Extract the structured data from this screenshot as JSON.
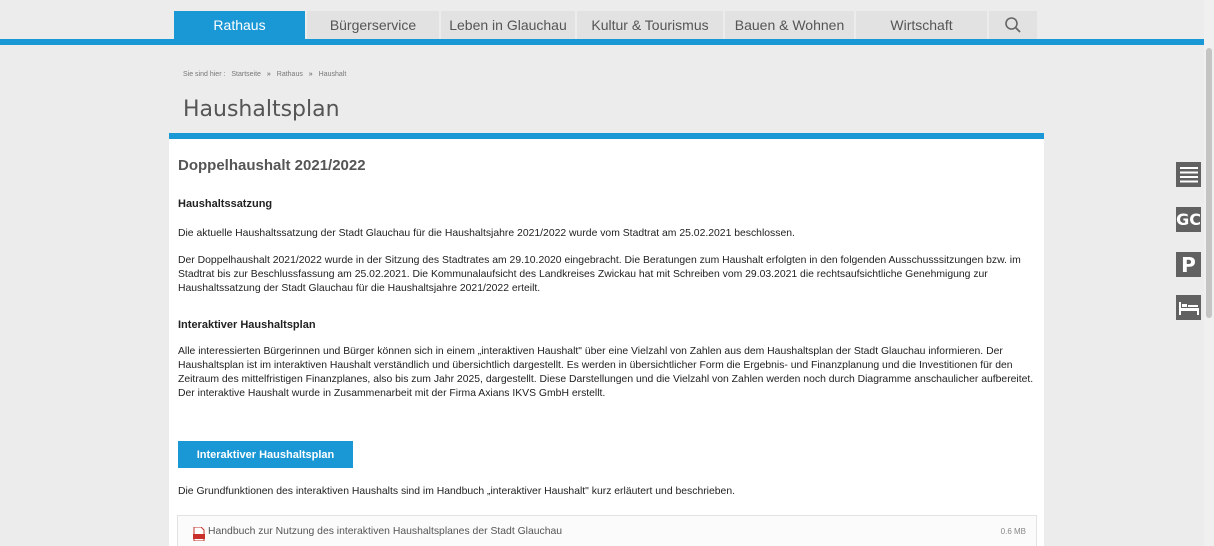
{
  "nav": {
    "items": [
      {
        "label": "Rathaus",
        "active": true
      },
      {
        "label": "Bürgerservice",
        "active": false
      },
      {
        "label": "Leben in Glauchau",
        "active": false
      },
      {
        "label": "Kultur & Tourismus",
        "active": false
      },
      {
        "label": "Bauen & Wohnen",
        "active": false
      },
      {
        "label": "Wirtschaft",
        "active": false
      }
    ],
    "search_icon": "search-icon"
  },
  "breadcrumb": {
    "prefix": "Sie sind hier :",
    "items": [
      "Startseite",
      "Rathaus",
      "Haushalt"
    ],
    "separator": "»"
  },
  "page_title": "Haushaltsplan",
  "content": {
    "section_title": "Doppelhaushalt 2021/2022",
    "heading1": "Haushaltssatzung",
    "para1": "Die aktuelle Haushaltssatzung der Stadt Glauchau für die Haushaltsjahre 2021/2022 wurde vom Stadtrat am 25.02.2021 beschlossen.",
    "para2": "Der Doppelhaushalt 2021/2022 wurde in der Sitzung des Stadtrates am 29.10.2020 eingebracht. Die Beratungen zum Haushalt erfolgten in den folgenden Ausschusssitzungen bzw. im Stadtrat bis zur Beschlussfassung am 25.02.2021. Die Kommunalaufsicht des Landkreises Zwickau hat mit Schreiben vom 29.03.2021 die rechtsaufsichtliche Genehmigung zur Haushaltssatzung der Stadt Glauchau für die Haushaltsjahre 2021/2022 erteilt.",
    "heading2": "Interaktiver Haushaltsplan",
    "para3": "Alle interessierten Bürgerinnen und Bürger können sich in einem „interaktiven Haushalt\" über eine Vielzahl von Zahlen aus dem Haushaltsplan der Stadt Glauchau informieren. Der Haushaltsplan ist im interaktiven Haushalt verständlich und übersichtlich dargestellt. Es werden in übersichtlicher Form die Ergebnis- und Finanzplanung und die Investitionen für den Zeitraum des mittelfristigen Finanzplanes, also bis zum Jahr 2025, dargestellt. Diese Darstellungen und die Vielzahl von Zahlen werden noch durch Diagramme anschaulicher aufbereitet. Der interaktive Haushalt wurde in Zusammenarbeit mit der Firma Axians IKVS GmbH erstellt.",
    "button_label": "Interaktiver Haushaltsplan",
    "para4": "Die Grundfunktionen des interaktiven Haushalts sind im Handbuch „interaktiver Haushalt\" kurz erläutert und beschrieben.",
    "download": {
      "icon": "pdf-icon",
      "label": "Handbuch zur Nutzung des interaktiven Haushaltsplanes der Stadt Glauchau",
      "size": "0.6 MB"
    }
  },
  "side_tools": [
    {
      "icon": "menu-lines-icon",
      "text": ""
    },
    {
      "icon": "gc-icon",
      "text": "GC"
    },
    {
      "icon": "parking-icon",
      "text": "P"
    },
    {
      "icon": "bed-icon",
      "text": ""
    }
  ],
  "colors": {
    "accent": "#1a97d5",
    "tool_bg": "#616161"
  }
}
